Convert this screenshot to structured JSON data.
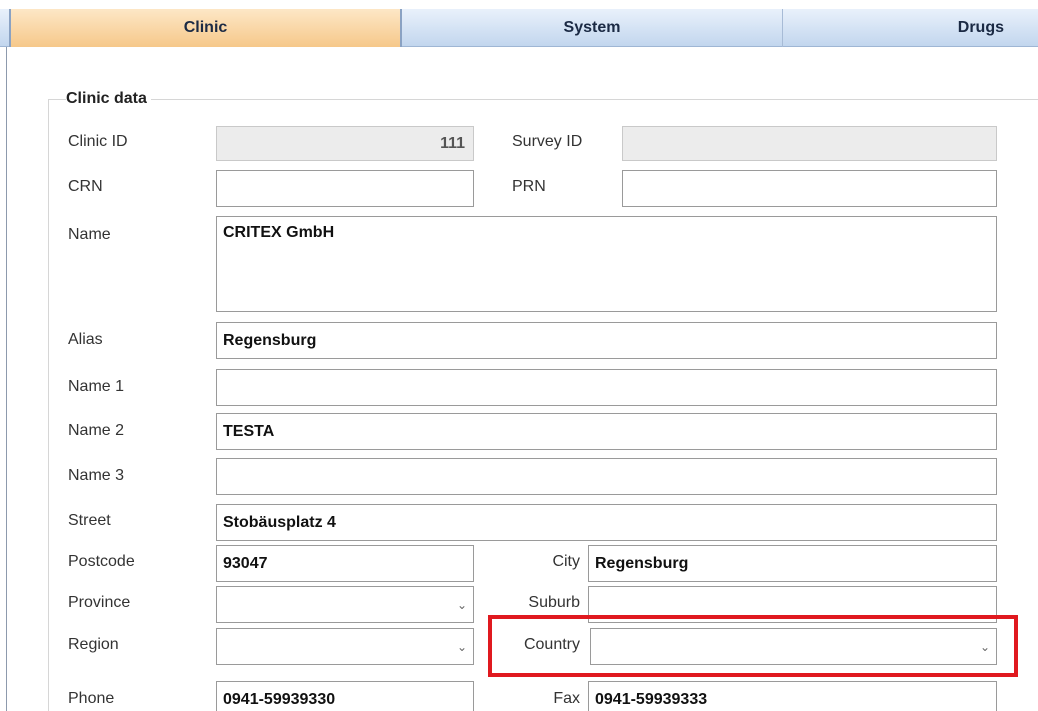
{
  "tabs": [
    {
      "label": "Clinic",
      "active": true
    },
    {
      "label": "System",
      "active": false
    },
    {
      "label": "Drugs",
      "active": false
    }
  ],
  "section": {
    "legend": "Clinic data"
  },
  "fields": {
    "clinic_id": {
      "label": "Clinic ID",
      "value": "111"
    },
    "survey_id": {
      "label": "Survey ID",
      "value": ""
    },
    "crn": {
      "label": "CRN",
      "value": ""
    },
    "prn": {
      "label": "PRN",
      "value": ""
    },
    "name": {
      "label": "Name",
      "value": "CRITEX GmbH"
    },
    "alias": {
      "label": "Alias",
      "value": "Regensburg"
    },
    "name1": {
      "label": "Name 1",
      "value": ""
    },
    "name2": {
      "label": "Name 2",
      "value": "TESTA"
    },
    "name3": {
      "label": "Name 3",
      "value": ""
    },
    "street": {
      "label": "Street",
      "value": "Stobäusplatz 4"
    },
    "postcode": {
      "label": "Postcode",
      "value": "93047"
    },
    "city": {
      "label": "City",
      "value": "Regensburg"
    },
    "province": {
      "label": "Province",
      "value": ""
    },
    "suburb": {
      "label": "Suburb",
      "value": ""
    },
    "region": {
      "label": "Region",
      "value": ""
    },
    "country": {
      "label": "Country",
      "value": ""
    },
    "phone": {
      "label": "Phone",
      "value": "0941-59939330"
    },
    "fax": {
      "label": "Fax",
      "value": "0941-59939333"
    }
  },
  "icons": {
    "dropdown": "chevron-down-icon"
  },
  "colors": {
    "highlight": "#e0191f",
    "active_tab": "#f6c88a"
  }
}
